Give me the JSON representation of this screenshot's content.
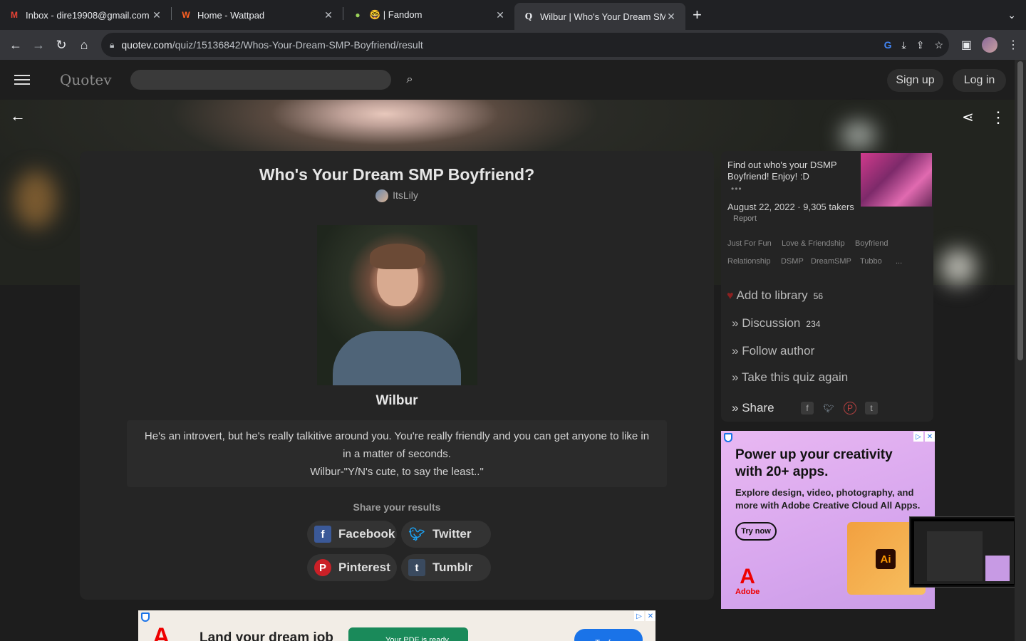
{
  "browser": {
    "tabs": [
      {
        "title": "Inbox - dire19908@gmail.com",
        "favicon": "gmail-icon",
        "active": false
      },
      {
        "title": "Home - Wattpad",
        "favicon": "wattpad-icon",
        "active": false
      },
      {
        "title": "🤓 | Fandom",
        "favicon": "fandom-icon",
        "active": false
      },
      {
        "title": "Wilbur | Who's Your Dream SMP",
        "favicon": "quotev-icon",
        "active": true
      }
    ],
    "url_domain": "quotev.com",
    "url_path": "/quiz/15136842/Whos-Your-Dream-SMP-Boyfriend/result"
  },
  "site": {
    "logo": "Quotev",
    "sign_up": "Sign up",
    "log_in": "Log in"
  },
  "quiz": {
    "title": "Who's Your Dream SMP Boyfriend?",
    "author": "ItsLily",
    "result_name": "Wilbur",
    "result_desc_1": "He's an introvert, but he's really talkitive around you. You're really friendly and you can get anyone to like in in a matter of seconds.",
    "result_desc_2": "Wilbur-\"Y/N's cute, to say the least..\"",
    "share_heading": "Share your results",
    "share_buttons": {
      "facebook": "Facebook",
      "twitter": "Twitter",
      "pinterest": "Pinterest",
      "tumblr": "Tumblr"
    }
  },
  "sidebar": {
    "blurb": "Find out who's your DSMP Boyfriend! Enjoy! :D",
    "more": "•••",
    "date_takers": "August 22, 2022 · 9,305 takers",
    "report": "Report",
    "tags": [
      "Just For Fun",
      "Love & Friendship",
      "Boyfriend",
      "Relationship",
      "DSMP",
      "DreamSMP",
      "Tubbo",
      "..."
    ],
    "add_to_library": "Add to library",
    "library_count": "56",
    "discussion": "Discussion",
    "discussion_count": "234",
    "follow_author": "Follow author",
    "take_again": "Take this quiz again",
    "share": "Share"
  },
  "ad_right": {
    "headline": "Power up your creativity with 20+ apps.",
    "body": "Explore design, video, photography, and more with Adobe Creative Cloud All Apps.",
    "cta": "Try now",
    "brand": "Adobe",
    "app_badge": "Ai"
  },
  "ad_bottom": {
    "headline": "Land your dream job",
    "pill": "Your PDF is ready",
    "cta": "Try free"
  }
}
